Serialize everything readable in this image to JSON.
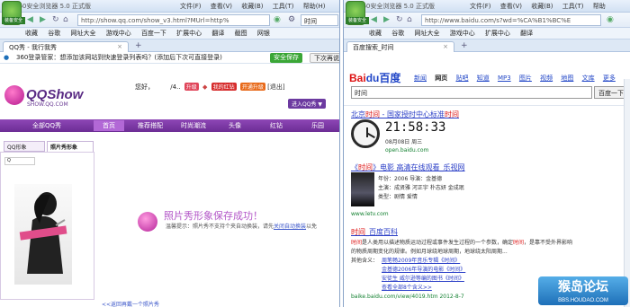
{
  "left": {
    "title": "360安全浏览器 5.0 正式版",
    "menus": [
      "文件(F)",
      "查看(V)",
      "收藏(B)",
      "工具(T)",
      "帮助(H)"
    ],
    "logo_tag": "装备安全",
    "url": "http://show.qq.com/show_v3.html?MUrl=http%",
    "search": "时间",
    "favs": [
      "收藏",
      "谷歌",
      "网址大全",
      "游戏中心",
      "百度一下",
      "扩展中心",
      "翻译",
      "截图",
      "网银"
    ],
    "tab": "QQ秀 - 我行我秀",
    "notice": "360登录管家：想添加该网站到快速登录列表吗？(添加后下次可直接登录)",
    "save_btn": "安全保存",
    "next_btn": "下次再说",
    "qq_logo": "QQShow",
    "qq_domain": "SHOW.QQ.COM",
    "greet": "您好，",
    "greet_suffix": "/4..",
    "badges": [
      "升级",
      "我的红钻",
      "开通升级"
    ],
    "exit": "[退出]",
    "qq_right_btn": "进入QQ秀 ▼",
    "nav": [
      "全部QQ秀",
      "首页",
      "推荐搭配",
      "时尚潮流",
      "头像",
      "红钻",
      "乐园"
    ],
    "subtabs": [
      "QQ形象",
      "照片秀形象"
    ],
    "success_text": "照片秀形象保存成功！",
    "hint_text": "温馨提示：照片秀不支持个夹自动换装，请先",
    "hint_link": "关闭自动换装",
    "hint_tail": "以免",
    "back_link": "<<返回再戴一个照片秀"
  },
  "right": {
    "title": "360安全浏览器 5.0 正式版",
    "menus": [
      "文件(F)",
      "查看(V)",
      "收藏(B)",
      "工具(T)",
      "帮助"
    ],
    "logo_tag": "装备安全",
    "url": "http://www.baidu.com/s?wd=%CA%B1%BC%E",
    "favs": [
      "收藏",
      "谷歌",
      "网址大全",
      "游戏中心",
      "扩展中心",
      "翻译"
    ],
    "tab": "百度搜索_时间",
    "logo_left": "Bai",
    "logo_right": "du百度",
    "nav": [
      "新闻",
      "网页",
      "贴吧",
      "知道",
      "MP3",
      "图片",
      "视频",
      "地图",
      "文库",
      "更多"
    ],
    "query": "时间",
    "search_btn": "百度一下",
    "r1_title_a": "北京",
    "r1_title_em": "时间",
    "r1_title_b": " - 国家授时中心标准",
    "r1_title_em2": "时间",
    "clock_time": "21:58:33",
    "clock_date": "08月08日  周三",
    "r1_site": "open.baidu.com",
    "r2_title_a": "《",
    "r2_title_em": "时间",
    "r2_title_b": "》电影 高清在线观看_乐视网",
    "r2_meta": [
      "年份：2006  导演：金基德",
      "主演：成贤雅  河正宇  朴志妍  金成珉",
      "类型：剧情  爱情"
    ],
    "r2_site": "www.letv.com",
    "r3_title_em": "时间",
    "r3_title_b": "_百度百科",
    "r3_line1_em": "时间",
    "r3_line1": "是人类用以描述物质运动过程或事件发生过程的一个参数，确定",
    "r3_line1_em2": "时间",
    "r3_line1_tail": "，是靠不受外界影响",
    "r3_line2": "的物质周期变化的规律。例如月球绕地球周期，地球绕太阳周期...",
    "r3_other": "其他含义：",
    "r3_links": [
      "周笔畅2009年音乐专辑《时间》",
      "金基德2006年导演的电影《时间》",
      "安徒生 威尔逊等编的图书《时间》"
    ],
    "r3_more": "查看全部8个含义>>",
    "r3_site": "baike.baidu.com/view/4019.htm 2012-8-7",
    "watermark": "猴岛论坛",
    "watermark_sub": "BBS.HOUDAO.COM"
  }
}
